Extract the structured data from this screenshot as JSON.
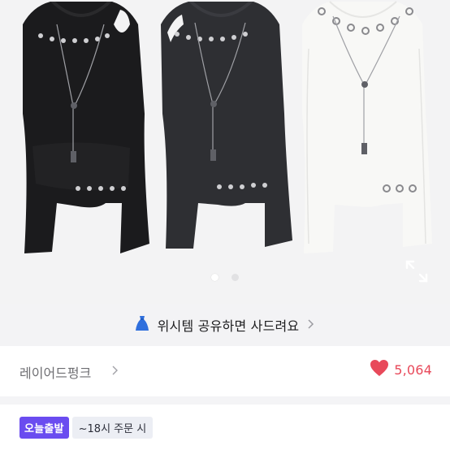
{
  "gallery": {
    "image_alt": "black, charcoal and white long-sleeve tops with necklace",
    "slide_count": 2,
    "active_slide": 1,
    "expand_icon": "expand-icon"
  },
  "wish_banner": {
    "icon": "dress-icon",
    "text": "위시템 공유하면 사드려요",
    "chevron": "chevron-right-icon"
  },
  "shop": {
    "name": "레이어드펑크",
    "chevron": "chevron-right-icon"
  },
  "like": {
    "icon": "heart-icon",
    "count": "5,064",
    "color": "#e8495a"
  },
  "shipping": {
    "badge": "오늘출발",
    "cutoff": "~18시 주문 시",
    "badge_color": "#6a4cf0"
  }
}
